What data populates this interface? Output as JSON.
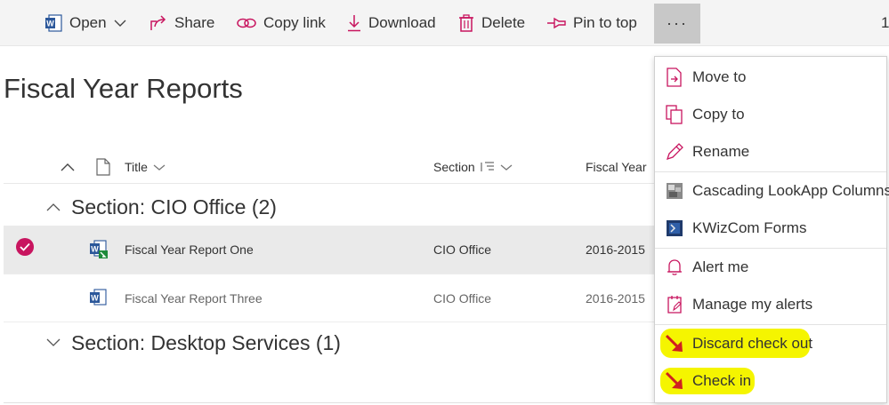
{
  "toolbar": {
    "open_label": "Open",
    "share_label": "Share",
    "copy_link_label": "Copy link",
    "download_label": "Download",
    "delete_label": "Delete",
    "pin_label": "Pin to top",
    "more_label": "···",
    "selected_count": "1"
  },
  "page": {
    "title": "Fiscal Year Reports"
  },
  "columns": {
    "title": "Title",
    "section": "Section",
    "fiscal_year": "Fiscal Year"
  },
  "groups": [
    {
      "label": "Section: CIO Office (2)",
      "rows": [
        {
          "title": "Fiscal Year Report One",
          "section": "CIO Office",
          "fiscal_year": "2016-2015"
        },
        {
          "title": "Fiscal Year Report Three",
          "section": "CIO Office",
          "fiscal_year": "2016-2015"
        }
      ]
    },
    {
      "label": "Section: Desktop Services (1)"
    }
  ],
  "menu": {
    "items": [
      {
        "label": "Move to",
        "icon": "move-icon"
      },
      {
        "label": "Copy to",
        "icon": "copy-icon"
      },
      {
        "label": "Rename",
        "icon": "pencil-icon"
      },
      {
        "label": "Cascading LookApp Columns",
        "icon": "lookapp-icon"
      },
      {
        "label": "KWizCom Forms",
        "icon": "kwizcom-icon"
      },
      {
        "label": "Alert me",
        "icon": "bell-icon"
      },
      {
        "label": "Manage my alerts",
        "icon": "manage-alerts-icon"
      },
      {
        "label": "Discard check out",
        "icon": "red-arrow-icon"
      },
      {
        "label": "Check in",
        "icon": "red-arrow-icon"
      }
    ]
  },
  "colors": {
    "accent": "#c8155f",
    "highlight": "#f5f500",
    "word_blue": "#2b579a",
    "arrow_red": "#d02020"
  }
}
